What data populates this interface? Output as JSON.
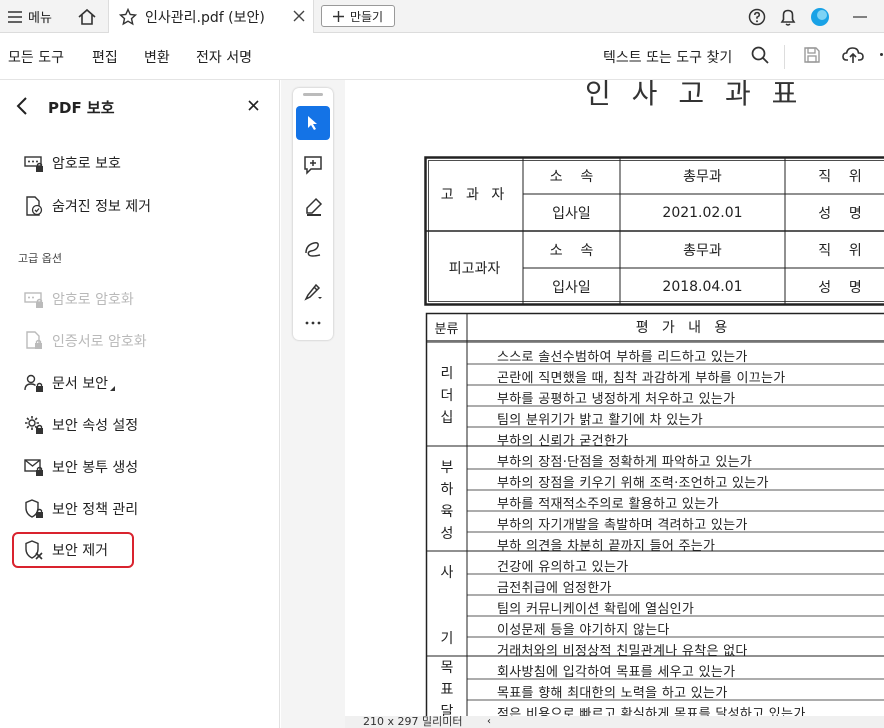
{
  "titlebar": {
    "menu_label": "메뉴",
    "tab_title": "인사관리.pdf (보안)",
    "new_tab_label": "만들기"
  },
  "menubar": {
    "items": [
      "모든 도구",
      "편집",
      "변환",
      "전자 서명"
    ],
    "search_label": "텍스트 또는 도구 찾기"
  },
  "panel": {
    "title": "PDF 보호",
    "items": [
      {
        "label": "암호로 보호",
        "disabled": false
      },
      {
        "label": "숨겨진 정보 제거",
        "disabled": false
      }
    ],
    "advanced_heading": "고급 옵션",
    "advanced_items": [
      {
        "label": "암호로 암호화",
        "disabled": true
      },
      {
        "label": "인증서로 암호화",
        "disabled": true
      },
      {
        "label": "문서 보안",
        "disabled": false
      },
      {
        "label": "보안 속성 설정",
        "disabled": false
      },
      {
        "label": "보안 봉투 생성",
        "disabled": false
      },
      {
        "label": "보안 정책 관리",
        "disabled": false
      },
      {
        "label": "보안 제거",
        "disabled": false,
        "highlighted": true
      }
    ],
    "highlight_color": "#d9232e"
  },
  "accent_color": "#1473e6",
  "document": {
    "title_partial": "인 사 고 과 표",
    "header_table": {
      "group1_label": "고 과 자",
      "group2_label": "피고과자",
      "rows": [
        {
          "label": "소    속",
          "value": "총무과",
          "right": "직    위"
        },
        {
          "label": "입사일",
          "value": "2021.02.01",
          "right": "성    명"
        },
        {
          "label": "소    속",
          "value": "총무과",
          "right": "직    위"
        },
        {
          "label": "입사일",
          "value": "2018.04.01",
          "right": "성    명"
        }
      ]
    },
    "eval_table": {
      "col_category": "분류",
      "col_content": "평   가   내   용",
      "groups": [
        {
          "category": "리\n더\n십",
          "rows": [
            "스스로 솔선수범하여 부하를 리드하고 있는가",
            "곤란에 직면했을 때, 침착 과감하게 부하를 이끄는가",
            "부하를 공평하고 냉정하게 처우하고 있는가",
            "팀의 분위기가 밝고 활기에 차 있는가",
            "부하의 신뢰가 굳건한가"
          ]
        },
        {
          "category": "부\n하\n육\n성",
          "rows": [
            "부하의 장점·단점을 정확하게 파악하고 있는가",
            "부하의 장점을 키우기 위해 조력·조언하고 있는가",
            "부하를 적재적소주의로 활용하고 있는가",
            "부하의 자기개발을 촉발하며 격려하고 있는가",
            "부하 의견을 차분히 끝까지 들어 주는가"
          ]
        },
        {
          "category": "사\n\n\n기",
          "rows": [
            "건강에 유의하고 있는가",
            "금전취급에 엄정한가",
            "팀의 커뮤니케이션 확립에 열심인가",
            "이성문제 등을 야기하지 않는다",
            "거래처와의 비정상적 친밀관계나 유착은 없다"
          ]
        },
        {
          "category": "목\n표\n달",
          "rows": [
            "회사방침에 입각하여 목표를 세우고 있는가",
            "목표를 향해 최대한의 노력을 하고 있는가",
            "적은 비용으로 빠르고 확실하게 목표를 달성하고 있는가"
          ]
        }
      ]
    },
    "page_size_label": "210 x 297 밀리미터"
  }
}
